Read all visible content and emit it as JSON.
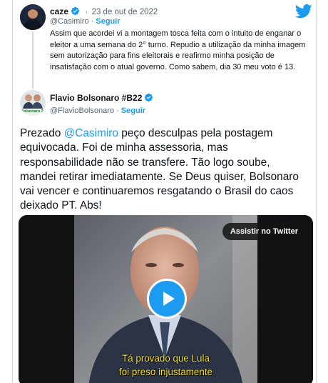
{
  "reply_tweet": {
    "author_name": "caze",
    "separator": "·",
    "date": "23 de out de 2022",
    "handle": "@Casimiro",
    "dot": "·",
    "follow_label": "Seguir",
    "text": "Assim que acordei vi a montagem tosca feita com o intuito de enganar o eleitor a uma semana do 2° turno. Repudio a utilização da minha imagem sem autorização para fins eleitorais e reafirmo minha posição de insatisfação com o atual governo. Como sabem, dia 30 meu voto é 13."
  },
  "main_tweet": {
    "author_name": "Flavio Bolsonaro #B22",
    "handle": "@FlavioBolsonaro",
    "dot": "·",
    "follow_label": "Seguir",
    "text_before_mention": "Prezado ",
    "mention": "@Casimiro",
    "text_after_mention": " peço desculpas pela postagem equivocada. Foi de minha assessoria, mas responsabilidade não se transfere. Tão logo soube, mandei retirar imediatamente. Se Deus quiser, Bolsonaro vai vencer e continuaremos resgatando o Brasil do caos deixado PT. Abs!",
    "avatar_badge": "Bolsonaro 22"
  },
  "video": {
    "watch_label": "Assistir no Twitter",
    "caption_line1": "Tá provado que Lula",
    "caption_line2": "foi preso injustamente"
  },
  "icons": {
    "brand": "twitter-bird-icon",
    "verified": "verified-badge-icon",
    "play": "play-icon"
  },
  "colors": {
    "accent": "#1d9bf0",
    "caption": "#f7e11c",
    "text": "#0f1419",
    "muted": "#536471"
  }
}
